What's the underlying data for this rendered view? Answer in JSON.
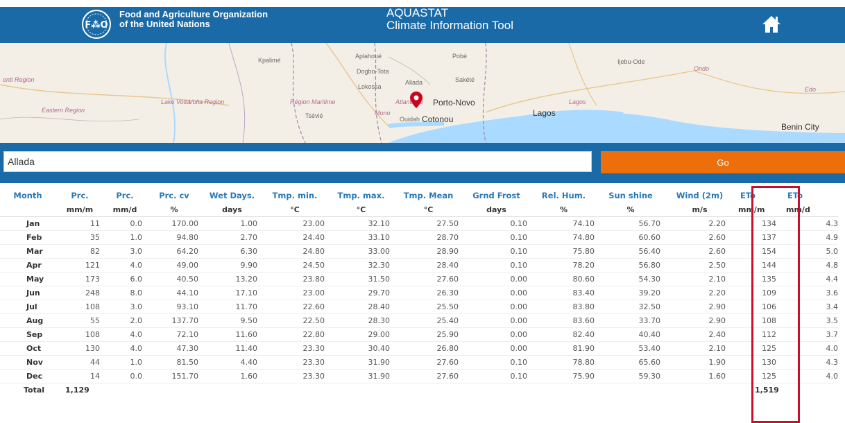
{
  "header": {
    "org_line1": "Food and Agriculture Organization",
    "org_line2": "of the United Nations",
    "title_line1": "AQUASTAT",
    "title_line2": "Climate Information Tool",
    "home_icon": "home-icon",
    "bg_color": "#1a6aa8"
  },
  "map": {
    "labels": [
      "onti Region",
      "Kpalimé",
      "Aplahoué",
      "Dogbo-Tota",
      "Lokossa",
      "Pobè",
      "Sakété",
      "Allada",
      "Atlantique",
      "Porto-Novo",
      "Ouidah",
      "Cotonou",
      "Ijebu-Ode",
      "Ondo",
      "Edo",
      "Lagos",
      "Benin City",
      "Eastern Region",
      "Lake Volta",
      "Volta Region",
      "Région Maritime",
      "Tsévié",
      "Mono",
      "Lagos"
    ],
    "marker": "map-pin-icon",
    "expand_icon": "chevron-double-down-icon",
    "expand_glyph": "»"
  },
  "search": {
    "value": "Allada",
    "go_label": "Go",
    "go_color": "#ec6f0b"
  },
  "table": {
    "columns": [
      {
        "name": "Month",
        "unit": ""
      },
      {
        "name": "Prc.",
        "unit": "mm/m"
      },
      {
        "name": "Prc.",
        "unit": "mm/d"
      },
      {
        "name": "Prc. cv",
        "unit": "%"
      },
      {
        "name": "Wet Days.",
        "unit": "days"
      },
      {
        "name": "Tmp. min.",
        "unit": "°C"
      },
      {
        "name": "Tmp. max.",
        "unit": "°C"
      },
      {
        "name": "Tmp. Mean",
        "unit": "°C"
      },
      {
        "name": "Grnd Frost",
        "unit": "days"
      },
      {
        "name": "Rel. Hum.",
        "unit": "%"
      },
      {
        "name": "Sun shine",
        "unit": "%"
      },
      {
        "name": "Wind (2m)",
        "unit": "m/s"
      },
      {
        "name": "ETo",
        "unit": "mm/m"
      },
      {
        "name": "ETo",
        "unit": "mm/d"
      }
    ],
    "rows": [
      [
        "Jan",
        "11",
        "0.0",
        "170.00",
        "1.00",
        "23.00",
        "32.10",
        "27.50",
        "0.10",
        "74.10",
        "56.70",
        "2.20",
        "134",
        "4.3"
      ],
      [
        "Feb",
        "35",
        "1.0",
        "94.80",
        "2.70",
        "24.40",
        "33.10",
        "28.70",
        "0.10",
        "74.80",
        "60.60",
        "2.60",
        "137",
        "4.9"
      ],
      [
        "Mar",
        "82",
        "3.0",
        "64.20",
        "6.30",
        "24.80",
        "33.00",
        "28.90",
        "0.10",
        "75.80",
        "56.40",
        "2.60",
        "154",
        "5.0"
      ],
      [
        "Apr",
        "121",
        "4.0",
        "49.00",
        "9.90",
        "24.50",
        "32.30",
        "28.40",
        "0.10",
        "78.20",
        "56.80",
        "2.50",
        "144",
        "4.8"
      ],
      [
        "May",
        "173",
        "6.0",
        "40.50",
        "13.20",
        "23.80",
        "31.50",
        "27.60",
        "0.00",
        "80.60",
        "54.30",
        "2.10",
        "135",
        "4.4"
      ],
      [
        "Jun",
        "248",
        "8.0",
        "44.10",
        "17.10",
        "23.00",
        "29.70",
        "26.30",
        "0.00",
        "83.40",
        "39.20",
        "2.20",
        "109",
        "3.6"
      ],
      [
        "Jul",
        "108",
        "3.0",
        "93.10",
        "11.70",
        "22.60",
        "28.40",
        "25.50",
        "0.00",
        "83.80",
        "32.50",
        "2.90",
        "106",
        "3.4"
      ],
      [
        "Aug",
        "55",
        "2.0",
        "137.70",
        "9.50",
        "22.50",
        "28.30",
        "25.40",
        "0.00",
        "83.60",
        "33.70",
        "2.90",
        "108",
        "3.5"
      ],
      [
        "Sep",
        "108",
        "4.0",
        "72.10",
        "11.60",
        "22.80",
        "29.00",
        "25.90",
        "0.00",
        "82.40",
        "40.40",
        "2.40",
        "112",
        "3.7"
      ],
      [
        "Oct",
        "130",
        "4.0",
        "47.30",
        "11.40",
        "23.30",
        "30.40",
        "26.80",
        "0.00",
        "81.90",
        "53.40",
        "2.10",
        "125",
        "4.0"
      ],
      [
        "Nov",
        "44",
        "1.0",
        "81.50",
        "4.40",
        "23.30",
        "31.90",
        "27.60",
        "0.10",
        "78.80",
        "65.60",
        "1.90",
        "130",
        "4.3"
      ],
      [
        "Dec",
        "14",
        "0.0",
        "151.70",
        "1.60",
        "23.30",
        "31.90",
        "27.60",
        "0.10",
        "75.90",
        "59.30",
        "1.60",
        "125",
        "4.0"
      ]
    ],
    "total": {
      "label": "Total",
      "prc_mm_m": "1,129",
      "eto_mm_m": "1,519"
    },
    "header_color": "#2a78b8",
    "highlight_color": "#c8102e"
  }
}
